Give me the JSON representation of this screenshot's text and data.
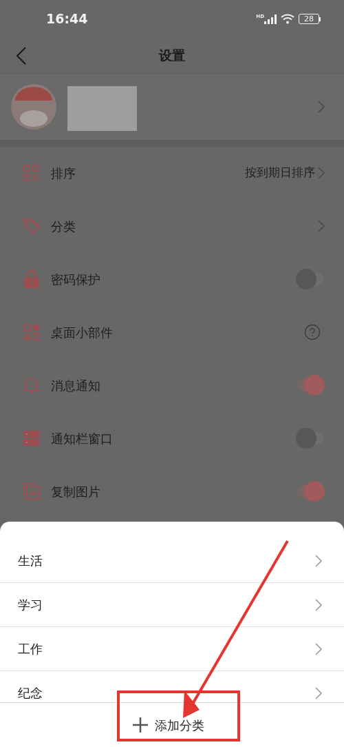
{
  "status_bar": {
    "time": "16:44",
    "network": "HD",
    "battery": "28"
  },
  "header": {
    "title": "设置"
  },
  "settings": [
    {
      "kind": "chevron",
      "label": "排序",
      "value": "按到期日排序"
    },
    {
      "kind": "chevron",
      "label": "分类"
    },
    {
      "kind": "toggle",
      "label": "密码保护",
      "on": false
    },
    {
      "kind": "help",
      "label": "桌面小部件"
    },
    {
      "kind": "toggle",
      "label": "消息通知",
      "on": true
    },
    {
      "kind": "toggle",
      "label": "通知栏窗口",
      "on": false
    },
    {
      "kind": "toggle",
      "label": "复制图片",
      "on": true
    }
  ],
  "category_sheet": {
    "items": [
      "生活",
      "学习",
      "工作",
      "纪念"
    ],
    "add_button": "添加分类"
  }
}
